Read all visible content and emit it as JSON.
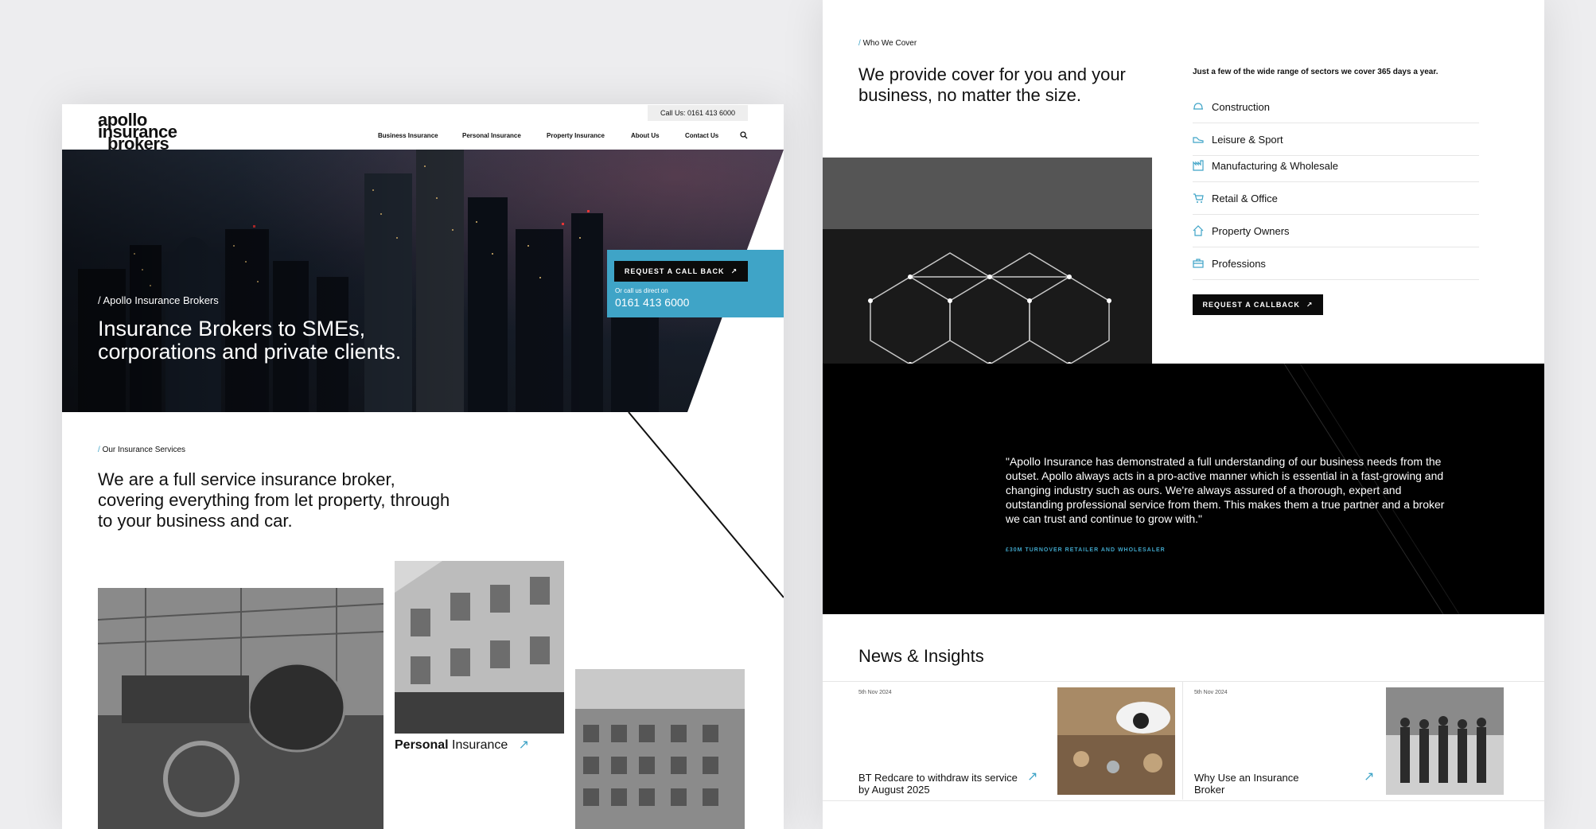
{
  "colors": {
    "accent": "#3fa4c7",
    "dark": "#0b0b0b",
    "page_bg": "#ededef"
  },
  "header": {
    "logo_lines": [
      "apollo",
      "insurance",
      "brokers"
    ],
    "call_us": "Call Us: 0161 413 6000",
    "nav": [
      "Business Insurance",
      "Personal Insurance",
      "Property Insurance",
      "About Us",
      "Contact Us"
    ],
    "search_icon": "search-icon"
  },
  "hero": {
    "crumb": "/ Apollo Insurance Brokers",
    "title": "Insurance Brokers to SMEs, corporations and private clients.",
    "cta_button": "REQUEST A CALL BACK",
    "cta_small": "Or call us direct on",
    "cta_phone": "0161 413 6000"
  },
  "services": {
    "crumb_slash": "/",
    "crumb": "Our Insurance Services",
    "lead": "We are a full service insurance broker, covering everything from let property, through to your business and car.",
    "cards": [
      {
        "bold": "Personal",
        "rest": " Insurance"
      }
    ]
  },
  "cover": {
    "crumb_slash": "/",
    "crumb": "Who We Cover",
    "lead": "We provide cover for you and your business, no matter the size.",
    "intro": "Just a few of the wide range of sectors we cover 365 days a year.",
    "sectors": [
      {
        "label": "Construction",
        "icon": "helmet-icon"
      },
      {
        "label": "Leisure & Sport",
        "icon": "shoe-icon"
      },
      {
        "label": "Manufacturing & Wholesale",
        "icon": "factory-icon"
      },
      {
        "label": "Retail & Office",
        "icon": "cart-icon"
      },
      {
        "label": "Property Owners",
        "icon": "house-icon"
      },
      {
        "label": "Professions",
        "icon": "briefcase-icon"
      }
    ],
    "button": "REQUEST A CALLBACK"
  },
  "testimonial": {
    "quote": "\"Apollo Insurance has demonstrated a full understanding of our business needs from the outset. Apollo always acts in a pro-active manner which is essential in a fast-growing and changing industry such as ours. We're always assured of a thorough, expert and outstanding professional service from them. This makes them a true partner and a broker we can trust and continue to grow with.\"",
    "source": "£30M TURNOVER RETAILER AND WHOLESALER"
  },
  "news": {
    "title": "News & Insights",
    "items": [
      {
        "date": "5th Nov 2024",
        "headline": "BT Redcare to withdraw its service by August 2025"
      },
      {
        "date": "5th Nov 2024",
        "headline": "Why Use an Insurance Broker"
      }
    ]
  }
}
